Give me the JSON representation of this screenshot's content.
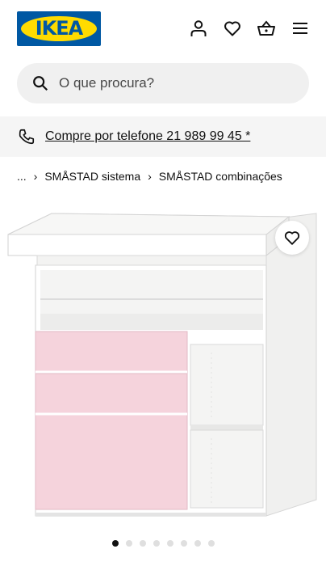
{
  "header": {
    "logo_text": "IKEA",
    "icons": [
      "profile-icon",
      "heart-icon",
      "basket-icon",
      "menu-icon"
    ]
  },
  "search": {
    "placeholder": "O que procura?",
    "icon": "search-icon"
  },
  "phone_bar": {
    "icon": "phone-icon",
    "text": "Compre por telefone 21 989 99 45 *"
  },
  "breadcrumb": {
    "items": [
      "...",
      "SMÅSTAD sistema",
      "SMÅSTAD combinações"
    ],
    "separator": "›"
  },
  "product_image": {
    "alt": "SMÅSTAD combinações",
    "favorite_icon": "heart-icon"
  },
  "carousel": {
    "total": 8,
    "active_index": 0
  },
  "colors": {
    "ikea_blue": "#0058a3",
    "ikea_yellow": "#ffdb00",
    "drawer_pink": "#f5d3dc"
  }
}
